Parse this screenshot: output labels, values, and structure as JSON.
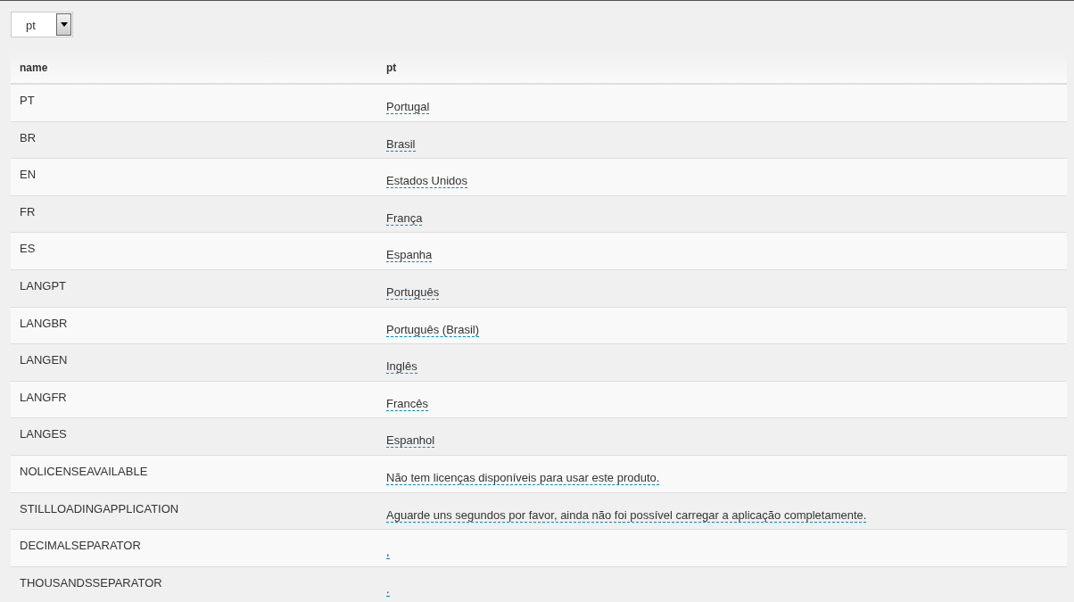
{
  "language_select": {
    "value": "pt"
  },
  "table": {
    "columns": [
      "name",
      "pt"
    ],
    "rows": [
      {
        "name": "PT",
        "value": "Portugal"
      },
      {
        "name": "BR",
        "value": "Brasil"
      },
      {
        "name": "EN",
        "value": "Estados Unidos"
      },
      {
        "name": "FR",
        "value": "França"
      },
      {
        "name": "ES",
        "value": "Espanha"
      },
      {
        "name": "LANGPT",
        "value": "Português"
      },
      {
        "name": "LANGBR",
        "value": "Português (Brasil)"
      },
      {
        "name": "LANGEN",
        "value": "Inglês"
      },
      {
        "name": "LANGFR",
        "value": "Francês"
      },
      {
        "name": "LANGES",
        "value": "Espanhol"
      },
      {
        "name": "NOLICENSEAVAILABLE",
        "value": "Não tem licenças disponíveis para usar este produto."
      },
      {
        "name": "STILLLOADINGAPPLICATION",
        "value": "Aguarde uns segundos por favor, ainda não foi possível carregar a aplicação completamente."
      },
      {
        "name": "DECIMALSEPARATOR",
        "value": ","
      },
      {
        "name": "THOUSANDSSEPARATOR",
        "value": "."
      }
    ]
  }
}
